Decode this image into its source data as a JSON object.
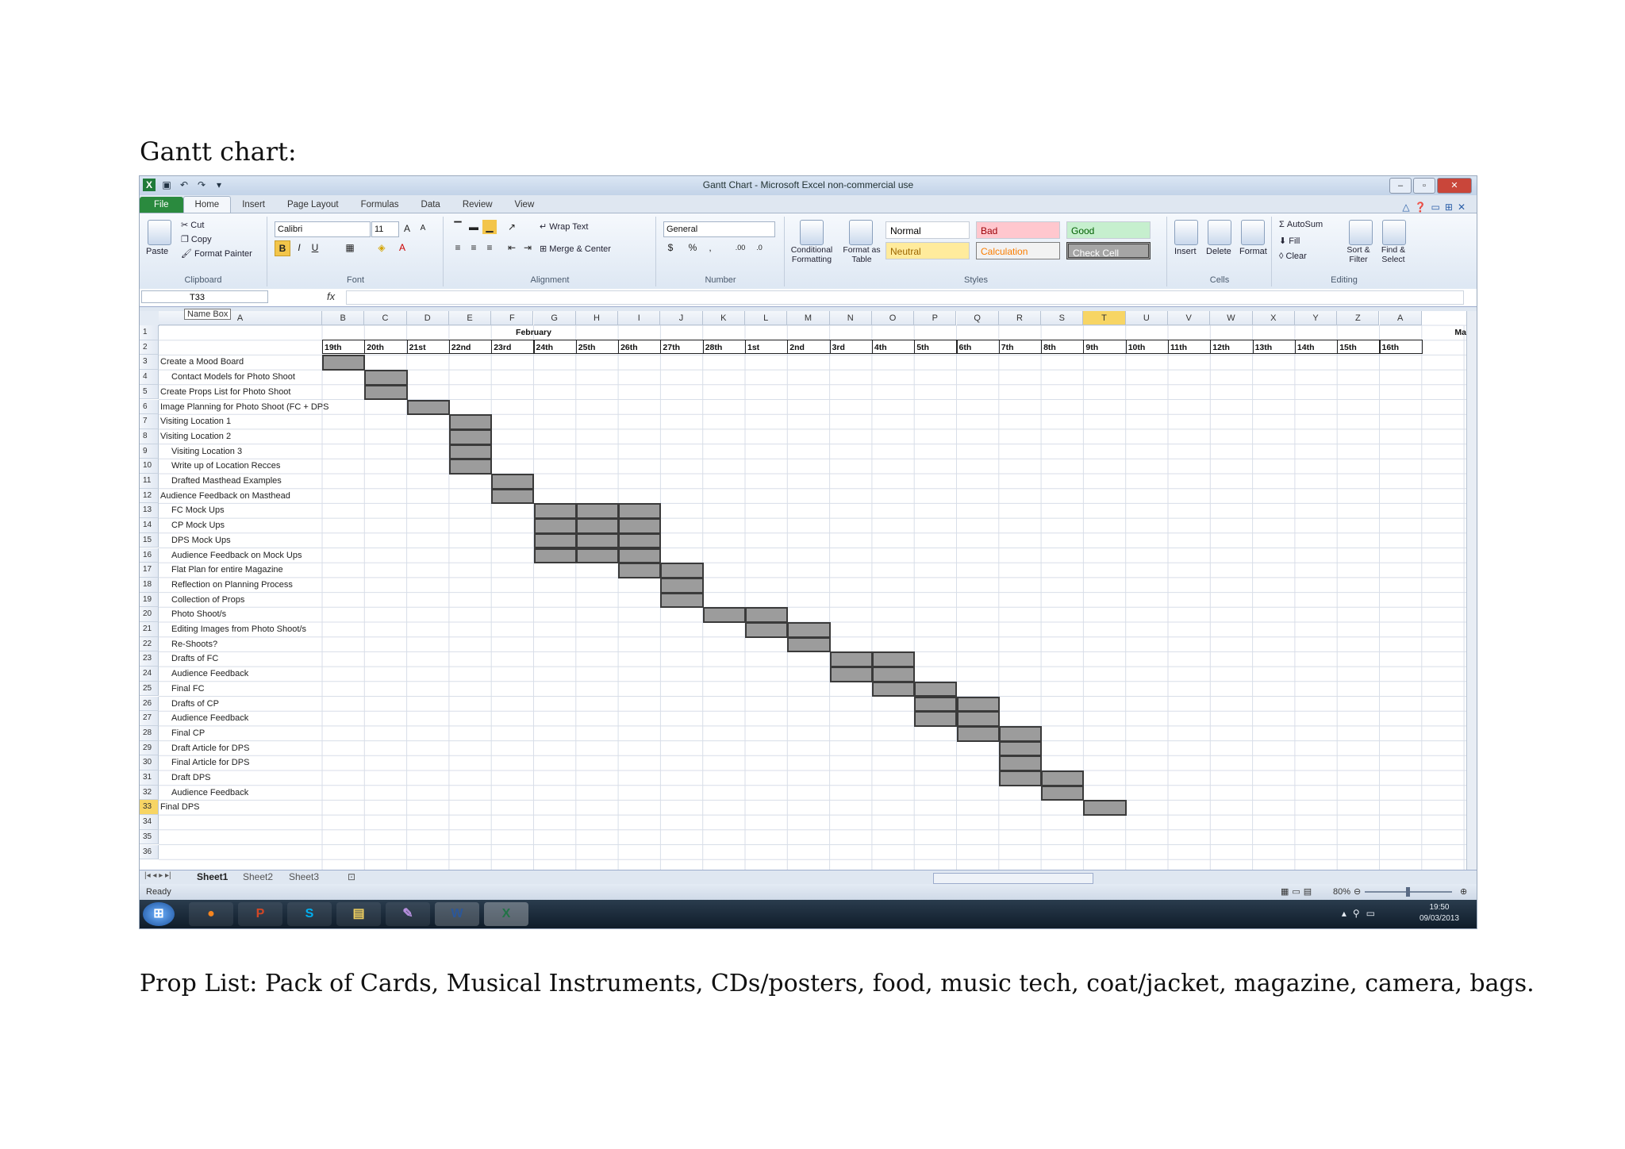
{
  "page": {
    "heading": "Gantt chart:",
    "footer": "Prop List: Pack of Cards, Musical Instruments, CDs/posters, food, music tech, coat/jacket, magazine, camera, bags."
  },
  "window": {
    "title": "Gantt Chart - Microsoft Excel non-commercial use",
    "tabs": [
      "File",
      "Home",
      "Insert",
      "Page Layout",
      "Formulas",
      "Data",
      "Review",
      "View"
    ]
  },
  "ribbon": {
    "clipboard": {
      "paste": "Paste",
      "cut": "Cut",
      "copy": "Copy",
      "format_painter": "Format Painter",
      "label": "Clipboard"
    },
    "font": {
      "name": "Calibri",
      "size": "11",
      "label": "Font"
    },
    "alignment": {
      "wrap": "Wrap Text",
      "merge": "Merge & Center",
      "label": "Alignment"
    },
    "number": {
      "format": "General",
      "label": "Number"
    },
    "styles": {
      "conditional": "Conditional Formatting",
      "format_table": "Format as Table",
      "normal": "Normal",
      "bad": "Bad",
      "good": "Good",
      "neutral": "Neutral",
      "calculation": "Calculation",
      "check_cell": "Check Cell",
      "label": "Styles"
    },
    "cells": {
      "insert": "Insert",
      "delete": "Delete",
      "format": "Format",
      "label": "Cells"
    },
    "editing": {
      "autosum": "AutoSum",
      "fill": "Fill",
      "clear": "Clear",
      "sort": "Sort & Filter",
      "find": "Find & Select",
      "label": "Editing"
    }
  },
  "formula_bar": {
    "name_box": "T33",
    "tooltip": "Name Box",
    "fx": "fx"
  },
  "grid": {
    "column_letters": [
      "A",
      "B",
      "C",
      "D",
      "E",
      "F",
      "G",
      "H",
      "I",
      "J",
      "K",
      "L",
      "M",
      "N",
      "O",
      "P",
      "Q",
      "R",
      "S",
      "T",
      "U",
      "V",
      "W",
      "X",
      "Y",
      "Z",
      "A"
    ],
    "selected_column": "T",
    "months": [
      {
        "label": "February"
      },
      {
        "label": "Ma"
      }
    ],
    "dates": [
      "19th",
      "20th",
      "21st",
      "22nd",
      "23rd",
      "24th",
      "25th",
      "26th",
      "27th",
      "28th",
      "1st",
      "2nd",
      "3rd",
      "4th",
      "5th",
      "6th",
      "7th",
      "8th",
      "9th",
      "10th",
      "11th",
      "12th",
      "13th",
      "14th",
      "15th",
      "16th"
    ],
    "rows": [
      {
        "n": "1",
        "task": ""
      },
      {
        "n": "2",
        "task": ""
      },
      {
        "n": "3",
        "task": "Create a Mood Board",
        "indent": false
      },
      {
        "n": "4",
        "task": "Contact Models for Photo Shoot",
        "indent": true
      },
      {
        "n": "5",
        "task": "Create Props List for Photo Shoot",
        "indent": false
      },
      {
        "n": "6",
        "task": "Image Planning for Photo Shoot (FC + DPS",
        "indent": false
      },
      {
        "n": "7",
        "task": "Visiting Location 1",
        "indent": false
      },
      {
        "n": "8",
        "task": "Visiting Location 2",
        "indent": false
      },
      {
        "n": "9",
        "task": "Visiting Location 3",
        "indent": true
      },
      {
        "n": "10",
        "task": "Write up of Location Recces",
        "indent": true
      },
      {
        "n": "11",
        "task": "Drafted Masthead Examples",
        "indent": true
      },
      {
        "n": "12",
        "task": "Audience Feedback on Masthead",
        "indent": false
      },
      {
        "n": "13",
        "task": "FC Mock Ups",
        "indent": true
      },
      {
        "n": "14",
        "task": "CP Mock Ups",
        "indent": true
      },
      {
        "n": "15",
        "task": "DPS Mock Ups",
        "indent": true
      },
      {
        "n": "16",
        "task": "Audience Feedback on Mock Ups",
        "indent": true
      },
      {
        "n": "17",
        "task": "Flat Plan for entire Magazine",
        "indent": true
      },
      {
        "n": "18",
        "task": "Reflection on Planning Process",
        "indent": true
      },
      {
        "n": "19",
        "task": "Collection of Props",
        "indent": true
      },
      {
        "n": "20",
        "task": "Photo Shoot/s",
        "indent": true
      },
      {
        "n": "21",
        "task": "Editing Images from Photo Shoot/s",
        "indent": true
      },
      {
        "n": "22",
        "task": "Re-Shoots?",
        "indent": true
      },
      {
        "n": "23",
        "task": "Drafts of FC",
        "indent": true
      },
      {
        "n": "24",
        "task": "Audience Feedback",
        "indent": true
      },
      {
        "n": "25",
        "task": "Final FC",
        "indent": true
      },
      {
        "n": "26",
        "task": "Drafts of CP",
        "indent": true
      },
      {
        "n": "27",
        "task": "Audience Feedback",
        "indent": true
      },
      {
        "n": "28",
        "task": "Final CP",
        "indent": true
      },
      {
        "n": "29",
        "task": "Draft Article for DPS",
        "indent": true
      },
      {
        "n": "30",
        "task": "Final Article for DPS",
        "indent": true
      },
      {
        "n": "31",
        "task": "Draft DPS",
        "indent": true
      },
      {
        "n": "32",
        "task": "Audience Feedback",
        "indent": true
      },
      {
        "n": "33",
        "task": "Final DPS",
        "indent": false,
        "selected": true
      },
      {
        "n": "34",
        "task": ""
      },
      {
        "n": "35",
        "task": ""
      },
      {
        "n": "36",
        "task": ""
      }
    ],
    "bars": [
      {
        "row": "3",
        "start": "19th",
        "end": "19th"
      },
      {
        "row": "4",
        "start": "20th",
        "end": "20th"
      },
      {
        "row": "5",
        "start": "20th",
        "end": "20th"
      },
      {
        "row": "6",
        "start": "21st",
        "end": "21st"
      },
      {
        "row": "7",
        "start": "22nd",
        "end": "22nd"
      },
      {
        "row": "8",
        "start": "22nd",
        "end": "22nd"
      },
      {
        "row": "9",
        "start": "22nd",
        "end": "22nd"
      },
      {
        "row": "10",
        "start": "22nd",
        "end": "22nd"
      },
      {
        "row": "11",
        "start": "23rd",
        "end": "23rd"
      },
      {
        "row": "12",
        "start": "23rd",
        "end": "23rd"
      },
      {
        "row": "13",
        "start": "24th",
        "end": "26th"
      },
      {
        "row": "14",
        "start": "24th",
        "end": "26th"
      },
      {
        "row": "15",
        "start": "24th",
        "end": "26th"
      },
      {
        "row": "16",
        "start": "24th",
        "end": "26th"
      },
      {
        "row": "17",
        "start": "26th",
        "end": "27th"
      },
      {
        "row": "18",
        "start": "27th",
        "end": "27th"
      },
      {
        "row": "19",
        "start": "27th",
        "end": "27th"
      },
      {
        "row": "20",
        "start": "28th",
        "end": "1st"
      },
      {
        "row": "21",
        "start": "1st",
        "end": "2nd"
      },
      {
        "row": "22",
        "start": "2nd",
        "end": "2nd"
      },
      {
        "row": "23",
        "start": "3rd",
        "end": "4th"
      },
      {
        "row": "24",
        "start": "3rd",
        "end": "4th"
      },
      {
        "row": "25",
        "start": "4th",
        "end": "5th"
      },
      {
        "row": "26",
        "start": "5th",
        "end": "6th"
      },
      {
        "row": "27",
        "start": "5th",
        "end": "6th"
      },
      {
        "row": "28",
        "start": "6th",
        "end": "7th"
      },
      {
        "row": "29",
        "start": "7th",
        "end": "7th"
      },
      {
        "row": "30",
        "start": "7th",
        "end": "7th"
      },
      {
        "row": "31",
        "start": "7th",
        "end": "8th"
      },
      {
        "row": "32",
        "start": "8th",
        "end": "8th"
      },
      {
        "row": "33",
        "start": "9th",
        "end": "9th"
      }
    ]
  },
  "sheets": [
    "Sheet1",
    "Sheet2",
    "Sheet3"
  ],
  "status": {
    "ready": "Ready",
    "zoom": "80%"
  },
  "taskbar": {
    "time": "19:50",
    "date": "09/03/2013"
  }
}
